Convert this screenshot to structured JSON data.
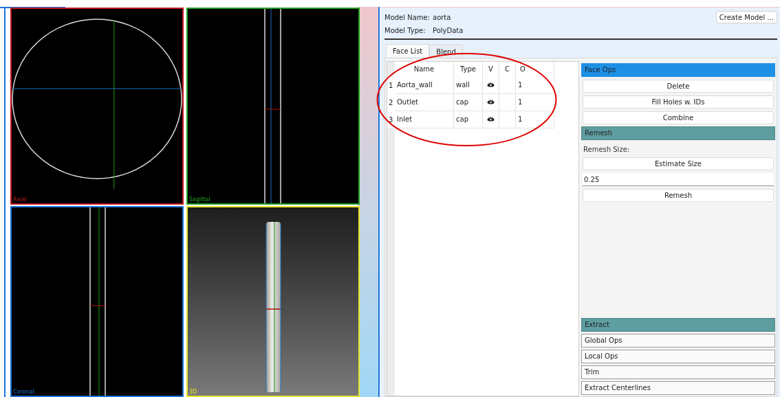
{
  "viewports": [
    {
      "label": "Axial",
      "kind": "axial"
    },
    {
      "label": "Sagittal",
      "kind": "sagittal"
    },
    {
      "label": "Coronal",
      "kind": "coronal"
    },
    {
      "label": "3D",
      "kind": "perspective"
    }
  ],
  "model": {
    "name_label": "Model Name:",
    "name": "aorta",
    "type_label": "Model Type:",
    "type": "PolyData",
    "create_button": "Create Model ..."
  },
  "tabs": [
    {
      "label": "Face List",
      "selected": true
    },
    {
      "label": "Blend",
      "selected": false
    }
  ],
  "table": {
    "columns": [
      "Name",
      "Type",
      "V",
      "C",
      "O"
    ],
    "rows": [
      {
        "index": "1",
        "name": "Aorta_wall",
        "type": "wall",
        "visible": true,
        "o": "1"
      },
      {
        "index": "2",
        "name": "Outlet",
        "type": "cap",
        "visible": true,
        "o": "1"
      },
      {
        "index": "3",
        "name": "Inlet",
        "type": "cap",
        "visible": true,
        "o": "1"
      }
    ]
  },
  "toolbox": [
    {
      "kind": "header",
      "title": "Face Ops",
      "selected": true
    },
    {
      "kind": "button",
      "label": "Delete"
    },
    {
      "kind": "button",
      "label": "Fill Holes w. IDs"
    },
    {
      "kind": "button",
      "label": "Combine"
    },
    {
      "kind": "header",
      "title": "Remesh",
      "selected": false,
      "active": true
    },
    {
      "kind": "label",
      "text": "Remesh Size:"
    },
    {
      "kind": "button",
      "label": "Estimate Size"
    },
    {
      "kind": "field",
      "value": "0.25"
    },
    {
      "kind": "button",
      "label": "Remesh"
    },
    {
      "kind": "spacer"
    },
    {
      "kind": "header",
      "title": "Extract",
      "selected": false,
      "active": true
    },
    {
      "kind": "header",
      "title": "Global Ops",
      "selected": false,
      "active": false
    },
    {
      "kind": "header",
      "title": "Local Ops",
      "selected": false,
      "active": false
    },
    {
      "kind": "header",
      "title": "Trim",
      "selected": false,
      "active": false
    },
    {
      "kind": "header",
      "title": "Extract Centerlines",
      "selected": false,
      "active": false
    }
  ]
}
